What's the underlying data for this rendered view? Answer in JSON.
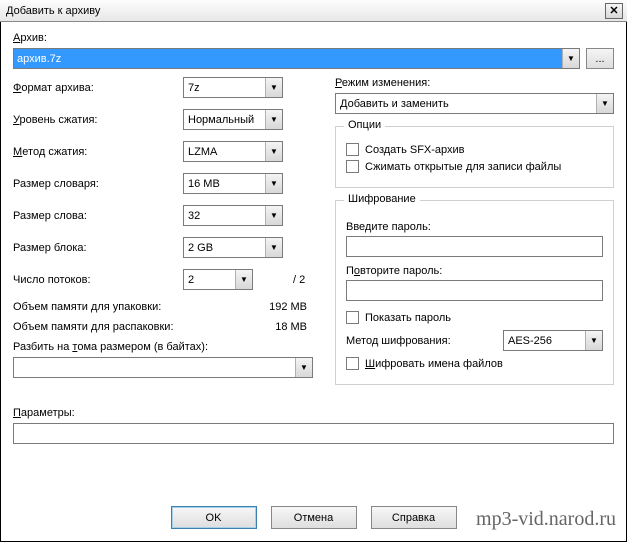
{
  "title": "Добавить к архиву",
  "archive": {
    "label": "Архив:",
    "label_u": "А",
    "label_rest": "рхив:",
    "value": "архив.7z",
    "browse": "..."
  },
  "left": {
    "format": {
      "label_u": "Ф",
      "label_rest": "ормат архива:",
      "value": "7z"
    },
    "level": {
      "label_u": "У",
      "label_rest": "ровень сжатия:",
      "value": "Нормальный"
    },
    "method": {
      "label_u": "М",
      "label_rest": "етод сжатия:",
      "value": "LZMA"
    },
    "dict": {
      "label": "Размер словаря:",
      "value": "16 MB"
    },
    "word": {
      "label": "Размер слова:",
      "value": "32"
    },
    "block": {
      "label": "Размер блока:",
      "value": "2 GB"
    },
    "threads": {
      "label": "Число потоков:",
      "value": "2",
      "suffix": "/ 2"
    },
    "mem_pack": {
      "label": "Объем памяти для упаковки:",
      "value": "192 MB"
    },
    "mem_unpack": {
      "label": "Объем памяти для распаковки:",
      "value": "18 MB"
    },
    "split": {
      "label_pre": "Разбить на ",
      "label_u": "т",
      "label_post": "ома размером (в байтах):",
      "value": ""
    }
  },
  "right": {
    "mode": {
      "label_u": "Р",
      "label_rest": "ежим изменения:",
      "value": "Добавить и заменить"
    },
    "options": {
      "legend": "Опции",
      "sfx": "Создать SFX-архив",
      "shared": "Сжимать открытые для записи файлы"
    },
    "enc": {
      "legend": "Шифрование",
      "pwd1": "Введите пароль:",
      "pwd2": {
        "pre": "П",
        "u": "о",
        "post": "вторите пароль:"
      },
      "show": "Показать пароль",
      "method_label": "Метод шифрования:",
      "method_value": "AES-256",
      "encnames": {
        "pre": "",
        "u": "Ш",
        "post": "ифровать имена файлов"
      }
    }
  },
  "params": {
    "label_u": "П",
    "label_rest": "араметры:",
    "value": ""
  },
  "buttons": {
    "ok": "OK",
    "cancel": "Отмена",
    "help": "Справка"
  },
  "watermark": "mp3-vid.narod.ru"
}
